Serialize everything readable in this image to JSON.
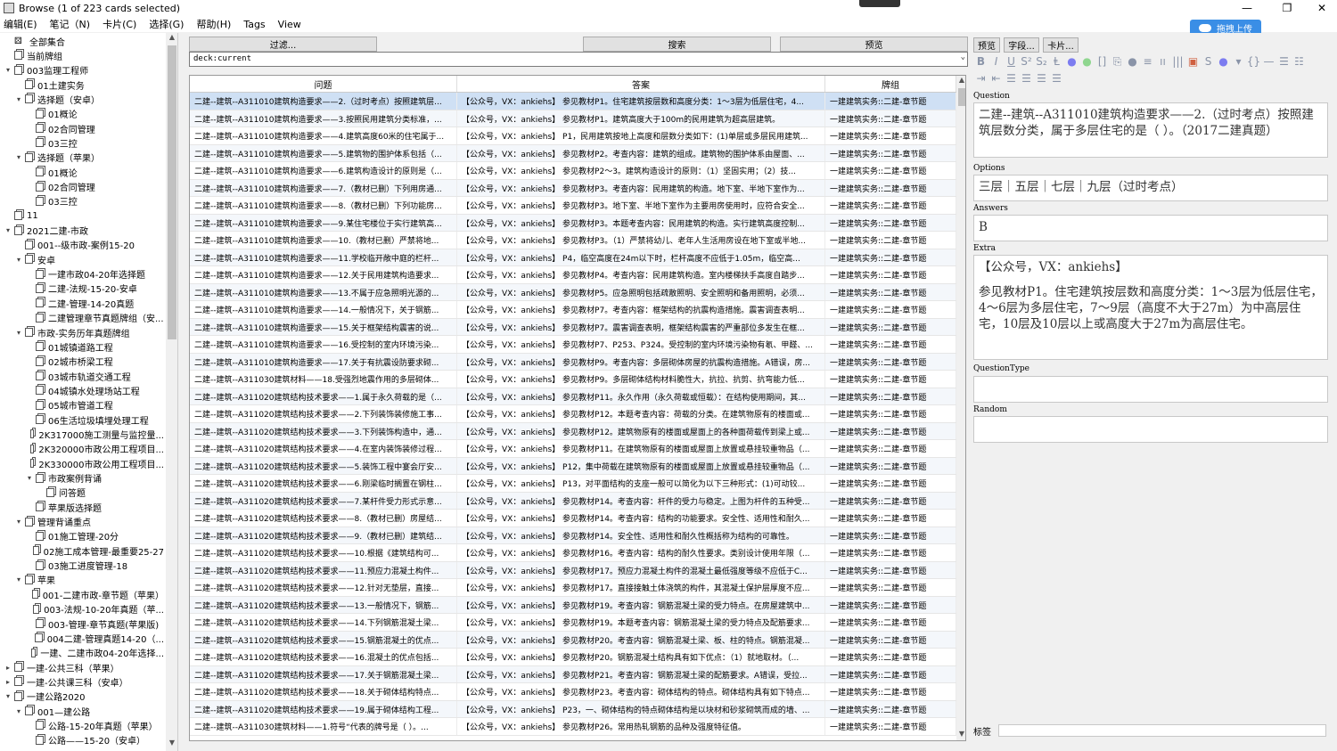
{
  "window": {
    "title": "Browse (1 of 223 cards selected)",
    "controls": {
      "minimize": "—",
      "maximize": "❐",
      "close": "✕"
    }
  },
  "menu": [
    "编辑(E)",
    "笔记（N)",
    "卡片(C)",
    "选择(G)",
    "帮助(H)",
    "Tags",
    "View"
  ],
  "upload_button": "拖拽上传",
  "sidebar": {
    "items": [
      {
        "label": "全部集合",
        "indent": 0,
        "tw": "",
        "icon": "collection-icon"
      },
      {
        "label": "当前牌组",
        "indent": 0,
        "tw": "",
        "icon": "deck-icon"
      },
      {
        "label": "003监理工程师",
        "indent": 0,
        "tw": "▾",
        "icon": "deck-icon"
      },
      {
        "label": "01土建实务",
        "indent": 1,
        "tw": "",
        "icon": "deck-icon"
      },
      {
        "label": "选择题（安卓）",
        "indent": 1,
        "tw": "▾",
        "icon": "deck-icon"
      },
      {
        "label": "01概论",
        "indent": 2,
        "tw": "",
        "icon": "deck-icon"
      },
      {
        "label": "02合同管理",
        "indent": 2,
        "tw": "",
        "icon": "deck-icon"
      },
      {
        "label": "03三控",
        "indent": 2,
        "tw": "",
        "icon": "deck-icon"
      },
      {
        "label": "选择题（苹果）",
        "indent": 1,
        "tw": "▾",
        "icon": "deck-icon"
      },
      {
        "label": "01概论",
        "indent": 2,
        "tw": "",
        "icon": "deck-icon"
      },
      {
        "label": "02合同管理",
        "indent": 2,
        "tw": "",
        "icon": "deck-icon"
      },
      {
        "label": "03三控",
        "indent": 2,
        "tw": "",
        "icon": "deck-icon"
      },
      {
        "label": "11",
        "indent": 0,
        "tw": "",
        "icon": "deck-icon"
      },
      {
        "label": "2021二建-市政",
        "indent": 0,
        "tw": "▾",
        "icon": "deck-icon"
      },
      {
        "label": "001--级市政-案例15-20",
        "indent": 1,
        "tw": "",
        "icon": "deck-icon"
      },
      {
        "label": "安卓",
        "indent": 1,
        "tw": "▾",
        "icon": "deck-icon"
      },
      {
        "label": "一建市政04-20年选择题",
        "indent": 2,
        "tw": "",
        "icon": "deck-icon"
      },
      {
        "label": "二建-法规-15-20-安卓",
        "indent": 2,
        "tw": "",
        "icon": "deck-icon"
      },
      {
        "label": "二建-管理-14-20真题",
        "indent": 2,
        "tw": "",
        "icon": "deck-icon"
      },
      {
        "label": "二建管理章节真题牌组（安...",
        "indent": 2,
        "tw": "",
        "icon": "deck-icon"
      },
      {
        "label": "市政-实务历年真题牌组",
        "indent": 1,
        "tw": "▾",
        "icon": "deck-icon"
      },
      {
        "label": "01城镇道路工程",
        "indent": 2,
        "tw": "",
        "icon": "deck-icon"
      },
      {
        "label": "02城市桥梁工程",
        "indent": 2,
        "tw": "",
        "icon": "deck-icon"
      },
      {
        "label": "03城市轨道交通工程",
        "indent": 2,
        "tw": "",
        "icon": "deck-icon"
      },
      {
        "label": "04城镇水处理场站工程",
        "indent": 2,
        "tw": "",
        "icon": "deck-icon"
      },
      {
        "label": "05城市管道工程",
        "indent": 2,
        "tw": "",
        "icon": "deck-icon"
      },
      {
        "label": "06生活垃圾填埋处理工程",
        "indent": 2,
        "tw": "",
        "icon": "deck-icon"
      },
      {
        "label": "2K317000施工测量与监控量...",
        "indent": 2,
        "tw": "",
        "icon": "deck-icon"
      },
      {
        "label": "2K320000市政公用工程项目...",
        "indent": 2,
        "tw": "",
        "icon": "deck-icon"
      },
      {
        "label": "2K330000市政公用工程项目...",
        "indent": 2,
        "tw": "",
        "icon": "deck-icon"
      },
      {
        "label": "市政案例背诵",
        "indent": 2,
        "tw": "▾",
        "icon": "deck-icon"
      },
      {
        "label": "问答题",
        "indent": 3,
        "tw": "",
        "icon": "deck-icon"
      },
      {
        "label": "苹果版选择题",
        "indent": 2,
        "tw": "",
        "icon": "deck-icon"
      },
      {
        "label": "管理背诵重点",
        "indent": 1,
        "tw": "▾",
        "icon": "deck-icon"
      },
      {
        "label": "01施工管理-20分",
        "indent": 2,
        "tw": "",
        "icon": "deck-icon"
      },
      {
        "label": "02施工成本管理-最重要25-27",
        "indent": 2,
        "tw": "",
        "icon": "deck-icon"
      },
      {
        "label": "03施工进度管理-18",
        "indent": 2,
        "tw": "",
        "icon": "deck-icon"
      },
      {
        "label": "苹果",
        "indent": 1,
        "tw": "▾",
        "icon": "deck-icon"
      },
      {
        "label": "001-二建市政-章节题（苹果）",
        "indent": 2,
        "tw": "",
        "icon": "deck-icon"
      },
      {
        "label": "003-法规-10-20年真题（苹...",
        "indent": 2,
        "tw": "",
        "icon": "deck-icon"
      },
      {
        "label": "003-管理-章节真题(苹果版)",
        "indent": 2,
        "tw": "",
        "icon": "deck-icon"
      },
      {
        "label": "004二建-管理真题14-20（...",
        "indent": 2,
        "tw": "",
        "icon": "deck-icon"
      },
      {
        "label": "一建、二建市政04-20年选择...",
        "indent": 2,
        "tw": "",
        "icon": "deck-icon"
      },
      {
        "label": "一建-公共三科（苹果）",
        "indent": 0,
        "tw": "▸",
        "icon": "deck-icon"
      },
      {
        "label": "一建-公共课三科（安卓）",
        "indent": 0,
        "tw": "▸",
        "icon": "deck-icon"
      },
      {
        "label": "一建公路2020",
        "indent": 0,
        "tw": "▾",
        "icon": "deck-icon"
      },
      {
        "label": "001—建公路",
        "indent": 1,
        "tw": "▾",
        "icon": "deck-icon"
      },
      {
        "label": "公路-15-20年真题（苹果）",
        "indent": 2,
        "tw": "",
        "icon": "deck-icon"
      },
      {
        "label": "公路——15-20（安卓）",
        "indent": 2,
        "tw": "",
        "icon": "deck-icon"
      }
    ]
  },
  "toolbar": {
    "filter": "过滤...",
    "search": "搜索",
    "preview": "预览"
  },
  "search": {
    "value": "deck:current"
  },
  "table": {
    "headers": [
      "问题",
      "答案",
      "牌组"
    ],
    "rows": [
      [
        "二建--建筑--A311010建筑构造要求——2.（过时考点）按照建筑层...",
        "【公众号，VX：ankiehs】 参见教材P1。住宅建筑按层数和高度分类：1～3层为低层住宅，4...",
        "一建建筑实务::二建-章节题"
      ],
      [
        "二建--建筑--A311010建筑构造要求——3.按照民用建筑分类标准，...",
        "【公众号，VX：ankiehs】 参见教材P1。建筑高度大于100m的民用建筑为超高层建筑。",
        "一建建筑实务::二建-章节题"
      ],
      [
        "二建--建筑--A311010建筑构造要求——4.建筑高度60米的住宅属于...",
        "【公众号，VX：ankiehs】 P1，民用建筑按地上高度和层数分类如下：(1)单层或多层民用建筑...",
        "一建建筑实务::二建-章节题"
      ],
      [
        "二建--建筑--A311010建筑构造要求——5.建筑物的围护体系包括（...",
        "【公众号，VX：ankiehs】 参见教材P2。考查内容：建筑的组成。建筑物的围护体系由屋面、...",
        "一建建筑实务::二建-章节题"
      ],
      [
        "二建--建筑--A311010建筑构造要求——6.建筑构造设计的原则是（...",
        "【公众号，VX：ankiehs】 参见教材P2～3。建筑构造设计的原则：（1）坚固实用；（2）技...",
        "一建建筑实务::二建-章节题"
      ],
      [
        "二建--建筑--A311010建筑构造要求——7.（教材已删）下列用房通...",
        "【公众号，VX：ankiehs】 参见教材P3。考查内容：民用建筑的构造。地下室、半地下室作为...",
        "一建建筑实务::二建-章节题"
      ],
      [
        "二建--建筑--A311010建筑构造要求——8.（教材已删）下列功能房...",
        "【公众号，VX：ankiehs】 参见教材P3。地下室、半地下室作为主要用房使用时，应符合安全...",
        "一建建筑实务::二建-章节题"
      ],
      [
        "二建--建筑--A311010建筑构造要求——9.某住宅楼位于实行建筑高...",
        "【公众号，VX：ankiehs】 参见教材P3。本题考查内容：民用建筑的构造。实行建筑高度控制...",
        "一建建筑实务::二建-章节题"
      ],
      [
        "二建--建筑--A311010建筑构造要求——10.（教材已删）严禁将地...",
        "【公众号，VX：ankiehs】 参见教材P3。（1）严禁将幼儿、老年人生活用房设在地下室或半地...",
        "一建建筑实务::二建-章节题"
      ],
      [
        "二建--建筑--A311010建筑构造要求——11.学校临开敞中庭的栏杆...",
        "【公众号，VX：ankiehs】 P4，临空高度在24m以下时，栏杆高度不应低于1.05m，临空高...",
        "一建建筑实务::二建-章节题"
      ],
      [
        "二建--建筑--A311010建筑构造要求——12.关于民用建筑构造要求...",
        "【公众号，VX：ankiehs】 参见教材P4。考查内容：民用建筑构造。室内楼梯扶手高度自踏步...",
        "一建建筑实务::二建-章节题"
      ],
      [
        "二建--建筑--A311010建筑构造要求——13.不属于应急照明光源的...",
        "【公众号，VX：ankiehs】 参见教材P5。应急照明包括疏散照明、安全照明和备用照明，必须...",
        "一建建筑实务::二建-章节题"
      ],
      [
        "二建--建筑--A311010建筑构造要求——14.一般情况下，关于钢筋...",
        "【公众号，VX：ankiehs】 参见教材P7。考查内容：框架结构的抗震构造措施。震害调查表明...",
        "一建建筑实务::二建-章节题"
      ],
      [
        "二建--建筑--A311010建筑构造要求——15.关于框架结构震害的说...",
        "【公众号，VX：ankiehs】 参见教材P7。震害调查表明，框架结构震害的严重部位多发生在框...",
        "一建建筑实务::二建-章节题"
      ],
      [
        "二建--建筑--A311010建筑构造要求——16.受控制的室内环境污染...",
        "【公众号，VX：ankiehs】 参见教材P7、P253、P324。受控制的室内环境污染物有氡、甲醛、...",
        "一建建筑实务::二建-章节题"
      ],
      [
        "二建--建筑--A311010建筑构造要求——17.关于有抗震设防要求砌...",
        "【公众号，VX：ankiehs】 参见教材P9。考查内容：多层砌体房屋的抗震构造措施。A错误，房...",
        "一建建筑实务::二建-章节题"
      ],
      [
        "二建--建筑--A311030建筑材料——18.受强烈地震作用的多层砌体...",
        "【公众号，VX：ankiehs】 参见教材P9。多层砌体结构材料脆性大，抗拉、抗剪、抗弯能力低...",
        "一建建筑实务::二建-章节题"
      ],
      [
        "二建--建筑--A311020建筑结构技术要求——1.属于永久荷载的是（...",
        "【公众号，VX：ankiehs】 参见教材P11。永久作用（永久荷载或恒载）：在结构使用期间，其...",
        "一建建筑实务::二建-章节题"
      ],
      [
        "二建--建筑--A311020建筑结构技术要求——2.下列装饰装修施工事...",
        "【公众号，VX：ankiehs】 参见教材P12。本题考查内容：荷载的分类。在建筑物原有的楼面或...",
        "一建建筑实务::二建-章节题"
      ],
      [
        "二建--建筑--A311020建筑结构技术要求——3.下列装饰构造中，通...",
        "【公众号，VX：ankiehs】 参见教材P12。建筑物原有的楼面或屋面上的各种面荷载传到梁上或...",
        "一建建筑实务::二建-章节题"
      ],
      [
        "二建--建筑--A311020建筑结构技术要求——4.在室内装饰装修过程...",
        "【公众号，VX：ankiehs】 参见教材P11。在建筑物原有的楼面或屋面上放置或悬挂较重物品（...",
        "一建建筑实务::二建-章节题"
      ],
      [
        "二建--建筑--A311020建筑结构技术要求——5.装饰工程中宴会厅安...",
        "【公众号，VX：ankiehs】 P12，集中荷载在建筑物原有的楼面或屋面上放置或悬挂较重物品（...",
        "一建建筑实务::二建-章节题"
      ],
      [
        "二建--建筑--A311020建筑结构技术要求——6.刚梁临时搁置在钢柱...",
        "【公众号，VX：ankiehs】 P13，对平面结构的支座一般可以简化为以下三种形式：(1)可动铰...",
        "一建建筑实务::二建-章节题"
      ],
      [
        "二建--建筑--A311020建筑结构技术要求——7.某杆件受力形式示意...",
        "【公众号，VX：ankiehs】 参见教材P14。考查内容：杆件的受力与稳定。上图为杆件的五种受...",
        "一建建筑实务::二建-章节题"
      ],
      [
        "二建--建筑--A311020建筑结构技术要求——8.（教材已删）房屋结...",
        "【公众号，VX：ankiehs】 参见教材P14。考查内容：结构的功能要求。安全性、适用性和耐久...",
        "一建建筑实务::二建-章节题"
      ],
      [
        "二建--建筑--A311020建筑结构技术要求——9.（教材已删）建筑结...",
        "【公众号，VX：ankiehs】 参见教材P14。安全性、适用性和耐久性概括称为结构的可靠性。",
        "一建建筑实务::二建-章节题"
      ],
      [
        "二建--建筑--A311020建筑结构技术要求——10.根据《建筑结构可...",
        "【公众号，VX：ankiehs】 参见教材P16。考查内容：结构的耐久性要求。类别设计使用年限（...",
        "一建建筑实务::二建-章节题"
      ],
      [
        "二建--建筑--A311020建筑结构技术要求——11.预应力混凝土构件...",
        "【公众号，VX：ankiehs】 参见教材P17。预应力混凝土构件的混凝土最低强度等级不应低于C...",
        "一建建筑实务::二建-章节题"
      ],
      [
        "二建--建筑--A311020建筑结构技术要求——12.针对无垫层，直接...",
        "【公众号，VX：ankiehs】 参见教材P17。直接接触土体浇筑的构件，其混凝土保护层厚度不应...",
        "一建建筑实务::二建-章节题"
      ],
      [
        "二建--建筑--A311020建筑结构技术要求——13.一般情况下，钢筋...",
        "【公众号，VX：ankiehs】 参见教材P19。考查内容：钢筋混凝土梁的受力特点。在房屋建筑中...",
        "一建建筑实务::二建-章节题"
      ],
      [
        "二建--建筑--A311020建筑结构技术要求——14.下列钢筋混凝土梁...",
        "【公众号，VX：ankiehs】 参见教材P19。本题考查内容：钢筋混凝土梁的受力特点及配筋要求...",
        "一建建筑实务::二建-章节题"
      ],
      [
        "二建--建筑--A311020建筑结构技术要求——15.钢筋混凝土的优点...",
        "【公众号，VX：ankiehs】 参见教材P20。考查内容：钢筋混凝土梁、板、柱的特点。钢筋混凝...",
        "一建建筑实务::二建-章节题"
      ],
      [
        "二建--建筑--A311020建筑结构技术要求——16.混凝土的优点包括...",
        "【公众号，VX：ankiehs】 参见教材P20。钢筋混凝土结构具有如下优点：（1）就地取材。（...",
        "一建建筑实务::二建-章节题"
      ],
      [
        "二建--建筑--A311020建筑结构技术要求——17.关于钢筋混凝土梁...",
        "【公众号，VX：ankiehs】 参见教材P21。考查内容：钢筋混凝土梁的配筋要求。A错误，受拉...",
        "一建建筑实务::二建-章节题"
      ],
      [
        "二建--建筑--A311020建筑结构技术要求——18.关于砌体结构特点...",
        "【公众号，VX：ankiehs】 参见教材P23。考查内容：砌体结构的特点。砌体结构具有如下特点...",
        "一建建筑实务::二建-章节题"
      ],
      [
        "二建--建筑--A311020建筑结构技术要求——19.属于砌体结构工程...",
        "【公众号，VX：ankiehs】 P23，一、砌体结构的特点砌体结构是以块材和砂浆砌筑而成的墙、...",
        "一建建筑实务::二建-章节题"
      ],
      [
        "二建--建筑--A311030建筑材料——1.符号“代表的牌号是（ ）。...",
        "【公众号，VX：ankiehs】 参见教材P26。常用热轧钢筋的品种及强度特征值。",
        "一建建筑实务::二建-章节题"
      ]
    ]
  },
  "editor": {
    "buttons": {
      "preview": "预览",
      "fields": "字段...",
      "cards": "卡片..."
    },
    "fields": [
      {
        "label": "Question",
        "value": "二建--建筑--A311010建筑构造要求——2.（过时考点）按照建筑层数分类，属于多层住宅的是（ ）。（2017二建真题）"
      },
      {
        "label": "Options",
        "value": "三层｜五层｜七层｜九层（过时考点）"
      },
      {
        "label": "Answers",
        "value": "B"
      },
      {
        "label": "Extra",
        "value": "【公众号，VX：ankiehs】",
        "value2": "参见教材P1。住宅建筑按层数和高度分类：1～3层为低层住宅，4～6层为多层住宅，7～9层（高度不大于27m）为中高层住宅，10层及10层以上或高度大于27m为高层住宅。"
      },
      {
        "label": "QuestionType",
        "value": ""
      },
      {
        "label": "Random",
        "value": ""
      }
    ],
    "tags_label": "标签"
  }
}
